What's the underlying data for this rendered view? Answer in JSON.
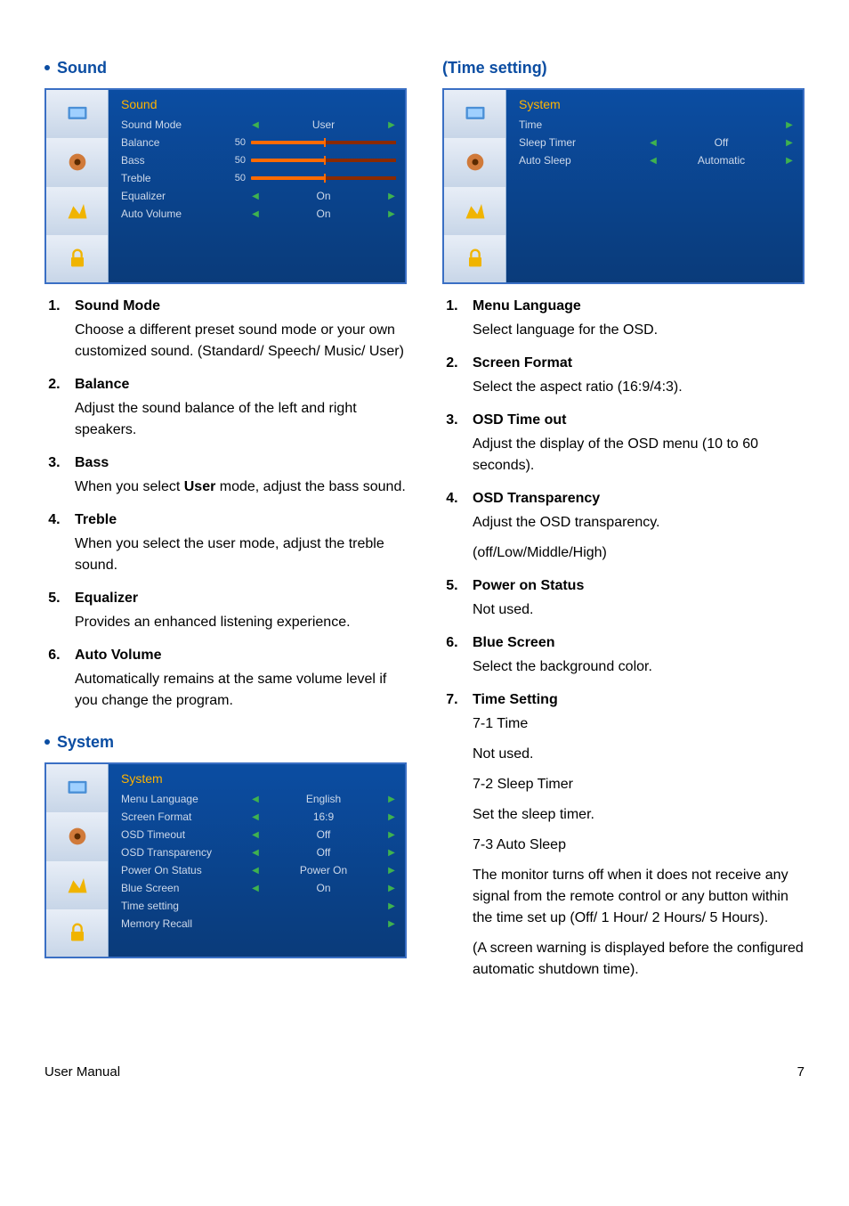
{
  "left": {
    "section_sound": "Sound",
    "section_system": "System",
    "osd_sound": {
      "title": "Sound",
      "rows": [
        {
          "label": "Sound Mode",
          "type": "arrows",
          "value": "User"
        },
        {
          "label": "Balance",
          "type": "slider",
          "mid": "50"
        },
        {
          "label": "Bass",
          "type": "slider",
          "mid": "50"
        },
        {
          "label": "Treble",
          "type": "slider",
          "mid": "50"
        },
        {
          "label": "Equalizer",
          "type": "arrows",
          "value": "On"
        },
        {
          "label": "Auto Volume",
          "type": "arrows",
          "value": "On"
        }
      ]
    },
    "osd_system": {
      "title": "System",
      "rows": [
        {
          "label": "Menu Language",
          "type": "arrows",
          "value": "English"
        },
        {
          "label": "Screen Format",
          "type": "arrows",
          "value": "16:9"
        },
        {
          "label": "OSD Timeout",
          "type": "arrows",
          "value": "Off"
        },
        {
          "label": "OSD Transparency",
          "type": "arrows",
          "value": "Off"
        },
        {
          "label": "Power On Status",
          "type": "arrows",
          "value": "Power On"
        },
        {
          "label": "Blue Screen",
          "type": "arrows",
          "value": "On"
        },
        {
          "label": "Time setting",
          "type": "right",
          "value": ""
        },
        {
          "label": "Memory Recall",
          "type": "right",
          "value": ""
        }
      ]
    },
    "items": [
      {
        "h": "Sound Mode",
        "b": "Choose a different preset sound mode or your own customized sound. (Standard/ Speech/ Music/ User)"
      },
      {
        "h": "Balance",
        "b": "Adjust the sound balance of the left and right speakers."
      },
      {
        "h": "Bass",
        "b_pre": "When you select ",
        "b_user": "User",
        "b_post": " mode, adjust the bass sound."
      },
      {
        "h": "Treble",
        "b": "When you select the user mode, adjust the treble sound."
      },
      {
        "h": "Equalizer",
        "b": "Provides an enhanced listening experience."
      },
      {
        "h": "Auto Volume",
        "b": "Automatically remains at the same volume level if you change the program."
      }
    ]
  },
  "right": {
    "section_time": "(Time setting)",
    "osd_time": {
      "title": "System",
      "rows": [
        {
          "label": "Time",
          "type": "right",
          "value": ""
        },
        {
          "label": "Sleep Timer",
          "type": "arrows",
          "value": "Off"
        },
        {
          "label": "Auto Sleep",
          "type": "arrows",
          "value": "Automatic"
        }
      ]
    },
    "items": [
      {
        "h": "Menu Language",
        "b": "Select language for the OSD."
      },
      {
        "h": "Screen Format",
        "b": "Select the aspect ratio (16:9/4:3)."
      },
      {
        "h": "OSD Time out",
        "b": "Adjust the display of the OSD menu (10 to 60 seconds)."
      },
      {
        "h": "OSD Transparency",
        "b": "Adjust the OSD transparency.",
        "b2": "(off/Low/Middle/High)"
      },
      {
        "h": "Power on Status",
        "b": "Not used."
      },
      {
        "h": "Blue Screen",
        "b": "Select the background color."
      }
    ],
    "time_heading": "Time Setting",
    "sub71_label": "7-1  Time",
    "sub71_body": "Not used.",
    "sub72_label": "7-2  Sleep Timer",
    "sub72_body": "Set the sleep timer.",
    "sub73_label": "7-3  Auto Sleep",
    "sub73_body1": "The monitor turns off when it does not receive any signal from the remote control or any button within the time set up (Off/ 1 Hour/ 2 Hours/ 5 Hours).",
    "sub73_body2": "(A screen warning is displayed before the configured automatic shutdown time)."
  },
  "footer_left": "User Manual",
  "footer_right": "7"
}
